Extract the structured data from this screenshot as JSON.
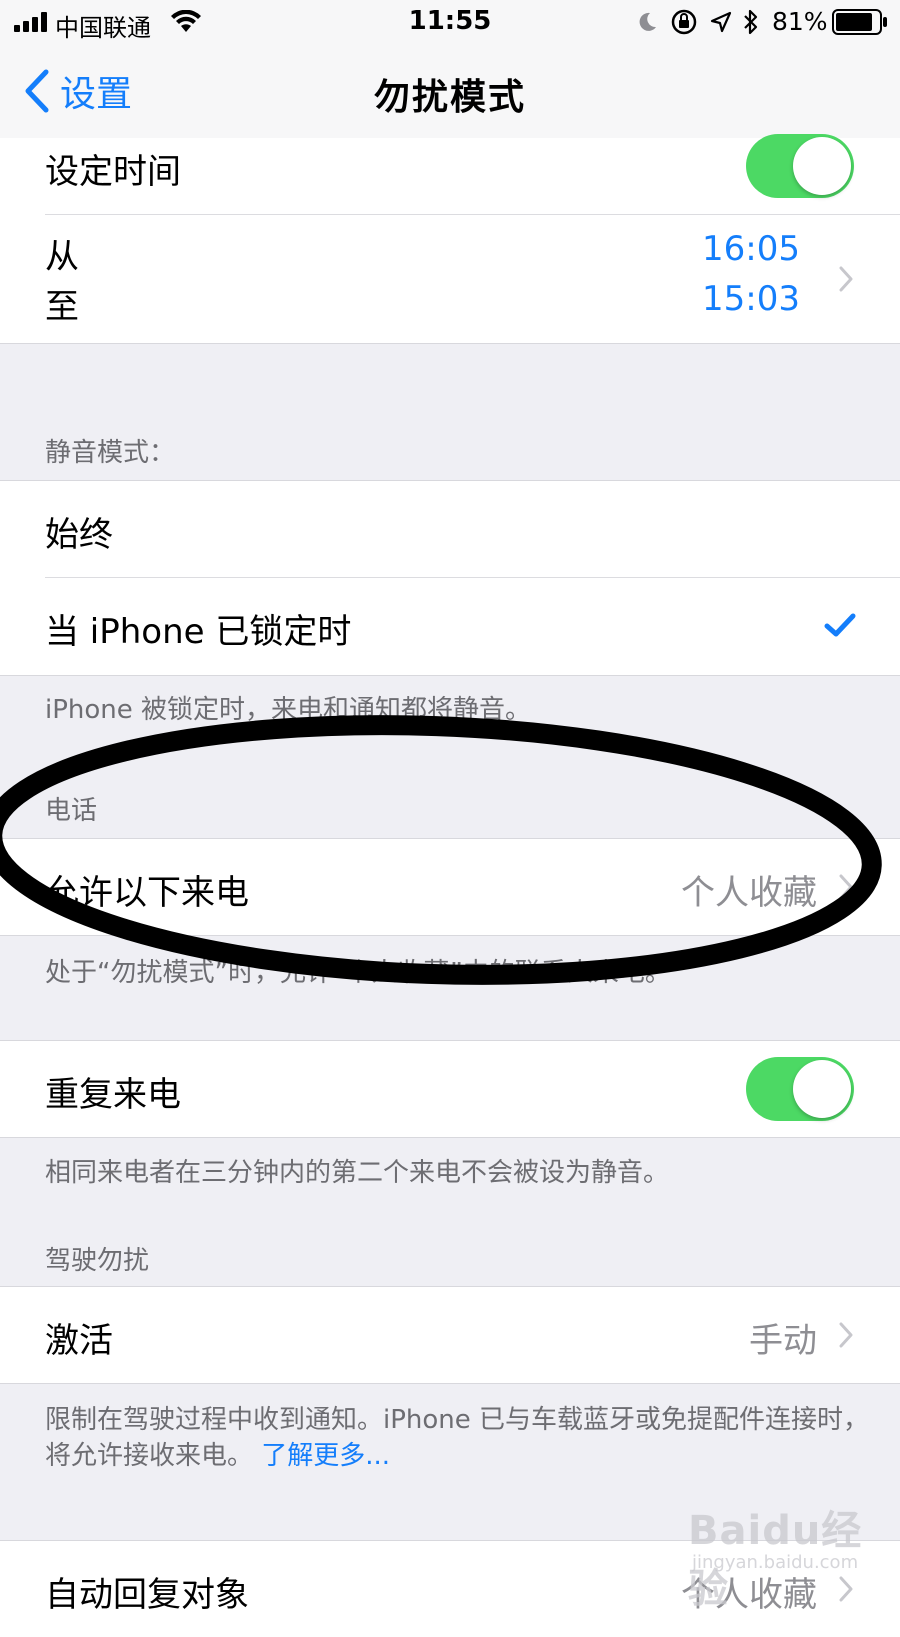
{
  "status_bar": {
    "carrier": "中国联通",
    "time": "11:55",
    "battery": "81%"
  },
  "nav": {
    "back_label": "设置",
    "title": "勿扰模式"
  },
  "schedule": {
    "label": "设定时间",
    "from_label": "从",
    "to_label": "至",
    "from_time": "16:05",
    "to_time": "15:03"
  },
  "silence": {
    "header": "静音模式：",
    "always_label": "始终",
    "locked_label": "当 iPhone 已锁定时",
    "note": "iPhone 被锁定时，来电和通知都将静音。"
  },
  "phone": {
    "header": "电话",
    "allow_label": "允许以下来电",
    "allow_value": "个人收藏",
    "note": "处于“勿扰模式”时，允许“个人收藏”中的联系人来电。",
    "repeat_label": "重复来电",
    "repeat_note": "相同来电者在三分钟内的第二个来电不会被设为静音。"
  },
  "driving": {
    "header": "驾驶勿扰",
    "activate_label": "激活",
    "activate_value": "手动",
    "note": "限制在驾驶过程中收到通知。iPhone 已与车载蓝牙或免提配件连接时，将允许接收来电。",
    "learn_more": "了解更多..."
  },
  "auto_reply": {
    "label": "自动回复对象",
    "value": "个人收藏"
  },
  "watermark": {
    "main": "Baidu经验",
    "sub": "jingyan.baidu.com"
  },
  "colors": {
    "accent": "#147efb",
    "toggle_on": "#4cd964",
    "background": "#efeff4"
  }
}
